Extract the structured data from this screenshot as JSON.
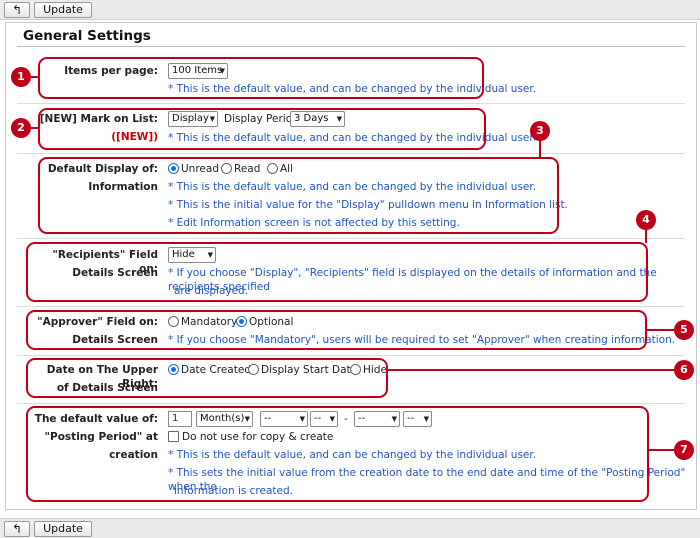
{
  "toolbar": {
    "back_icon": "↰",
    "update_label": "Update"
  },
  "page": {
    "title": "General Settings"
  },
  "items_per_page": {
    "label": "Items per page:",
    "selected": "100 Items",
    "note": "* This is the default value, and can be changed by the individual user."
  },
  "new_mark": {
    "label": "[NEW] Mark on List:",
    "sublabel": "([NEW])",
    "display_selected": "Display",
    "period_label": "Display Period",
    "period_selected": "3 Days",
    "note": "* This is the default value, and can be changed by the individual user."
  },
  "default_display": {
    "label1": "Default Display of:",
    "label2": "Information",
    "options": [
      "Unread",
      "Read",
      "All"
    ],
    "selected": "Unread",
    "notes": [
      "* This is the default value, and can be changed by the individual user.",
      "* This is the initial value for the \"Display\" pulldown menu in Information list.",
      "* Edit Information screen is not affected by this setting."
    ]
  },
  "recipients": {
    "label1": "\"Recipients\" Field on:",
    "label2": "Details Screen",
    "selected": "Hide",
    "note1": "* If you choose \"Display\", \"Recipients\" field is displayed on the details of information and the recipients specified",
    "note2": "are displayed."
  },
  "approver": {
    "label1": "\"Approver\" Field on:",
    "label2": "Details Screen",
    "options": [
      "Mandatory",
      "Optional"
    ],
    "selected": "Optional",
    "note": "* If you choose \"Mandatory\", users will be required to set \"Approver\" when creating information."
  },
  "date_upper_right": {
    "label1": "Date on The Upper Right:",
    "label2": "of Details Screen",
    "options": [
      "Date Created",
      "Display Start Date",
      "Hide"
    ],
    "selected": "Date Created"
  },
  "posting_period": {
    "label1": "The default value of:",
    "label2": "\"Posting Period\" at",
    "label3": "creation",
    "value": "1",
    "unit_selected": "Month(s)",
    "dash": "--",
    "range_sep": "-",
    "checkbox_label": "Do not use for copy & create",
    "notes": [
      "* This is the default value, and can be changed by the individual user.",
      "* This sets the initial value from the creation date to the end date and time of the \"Posting Period\" when the",
      "information is created."
    ]
  },
  "callouts": [
    "1",
    "2",
    "3",
    "4",
    "5",
    "6",
    "7"
  ],
  "colors": {
    "highlight": "#c0001a",
    "note_text": "#2255bb",
    "required_text": "#d00000",
    "radio_selected": "#1a6fd8"
  }
}
